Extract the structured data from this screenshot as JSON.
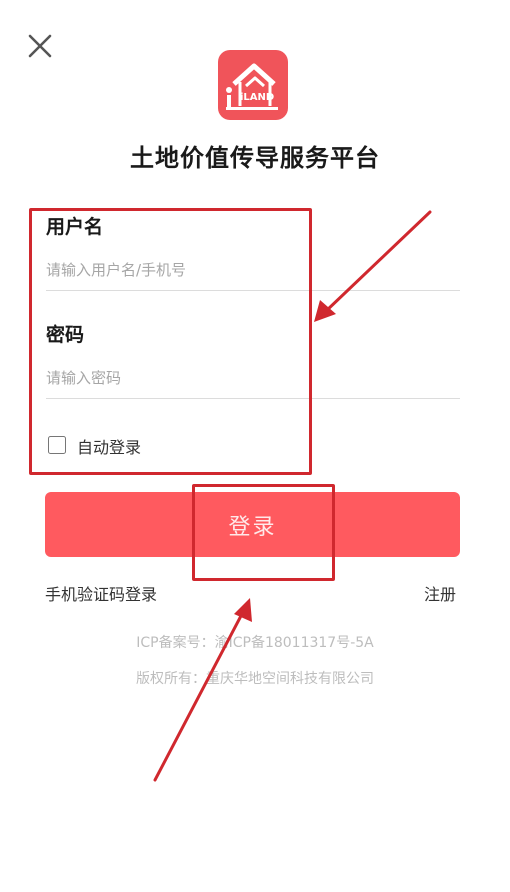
{
  "app": {
    "title": "土地价值传导服务平台",
    "logo_text": "iLAND",
    "brand_color": "#f0545a"
  },
  "form": {
    "username_label": "用户名",
    "username_placeholder": "请输入用户名/手机号",
    "username_value": "",
    "password_label": "密码",
    "password_placeholder": "请输入密码",
    "password_value": "",
    "auto_login_label": "自动登录",
    "auto_login_checked": false,
    "login_button_label": "登录",
    "login_button_color": "#ff5a5f"
  },
  "links": {
    "sms_login": "手机验证码登录",
    "register": "注册"
  },
  "footer": {
    "icp": "ICP备案号：渝ICP备18011317号-5A",
    "copyright": "版权所有：重庆华地空间科技有限公司"
  },
  "icons": {
    "close": "close-icon",
    "logo": "iland-logo-icon"
  },
  "annotation_color": "#d0282e"
}
